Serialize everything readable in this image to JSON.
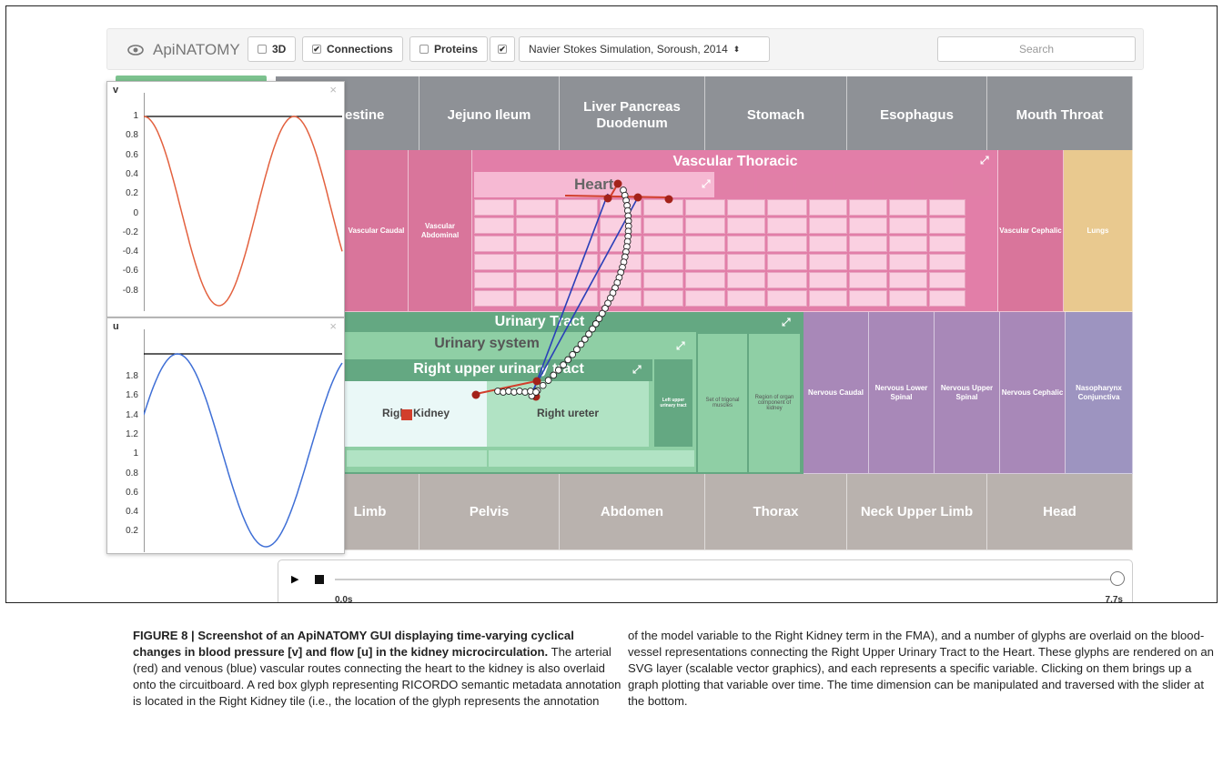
{
  "navbar": {
    "brand": "ApiNATOMY",
    "toggle_3d": "3D",
    "toggle_connections": "Connections",
    "toggle_proteins": "Proteins",
    "simulation_select": "Navier Stokes Simulation, Soroush, 2014",
    "search_placeholder": "Search",
    "check_mark": "✔"
  },
  "tiles": {
    "top_row": [
      "Intestine",
      "Jejuno Ileum",
      "Liver Pancreas Duodenum",
      "Stomach",
      "Esophagus",
      "Mouth Throat"
    ],
    "vascular_caudal": "Vascular Caudal",
    "vascular_abdominal": "Vascular Abdominal",
    "vascular_thoracic": "Vascular Thoracic",
    "heart": "Heart",
    "vascular_cephalic": "Vascular Cephalic",
    "lungs": "Lungs",
    "urinary_tract": "Urinary Tract",
    "urinary_system": "Urinary system",
    "right_upper_urinary_tract": "Right upper urinary tract",
    "right_kidney": "Right Kidney",
    "right_ureter": "Right ureter",
    "left_upper_urinary_tract": "Left upper urinary tract",
    "trigonal_muscles": "Set of trigonal muscles",
    "organ_component": "Region of organ component of kidney",
    "nervous": [
      "Nervous Caudal",
      "Nervous Lower Spinal",
      "Nervous Upper Spinal",
      "Nervous Cephalic",
      "Nasopharynx Conjunctiva"
    ],
    "bottom_row": [
      "Limb",
      "Pelvis",
      "Abdomen",
      "Thorax",
      "Neck Upper Limb",
      "Head"
    ]
  },
  "panels": {
    "v": {
      "title": "v",
      "close": "×",
      "yticks": [
        "1",
        "0.8",
        "0.6",
        "0.4",
        "0.2",
        "0",
        "-0.2",
        "-0.4",
        "-0.6",
        "-0.8"
      ],
      "color": "#e3613f"
    },
    "u": {
      "title": "u",
      "close": "×",
      "yticks": [
        "1.8",
        "1.6",
        "1.4",
        "1.2",
        "1",
        "0.8",
        "0.6",
        "0.4",
        "0.2"
      ],
      "color": "#3f6fd6"
    }
  },
  "timeline": {
    "start": "0.0s",
    "end": "7.7s",
    "position": 1.0
  },
  "glyph_color": "#d23f2c",
  "caption": {
    "figure_title": "FIGURE 8 | Screenshot of an ApiNATOMY GUI displaying time-varying cyclical changes in blood pressure [v] and flow [u] in the kidney microcirculation.",
    "left_body": "The arterial (red) and venous (blue) vascular routes connecting the heart to the kidney is also overlaid onto the circuitboard. A red box glyph representing RICORDO semantic metadata annotation is located in the Right Kidney tile (i.e., the location of the glyph represents the annotation",
    "right_body": "of the model variable to the Right Kidney term in the FMA), and a number of glyphs are overlaid on the blood-vessel representations connecting the Right Upper Urinary Tract to the Heart. These glyphs are rendered on an SVG layer (scalable vector graphics), and each represents a specific variable. Clicking on them brings up a graph plotting that variable over time. The time dimension can be manipulated and traversed with the slider at the bottom."
  }
}
